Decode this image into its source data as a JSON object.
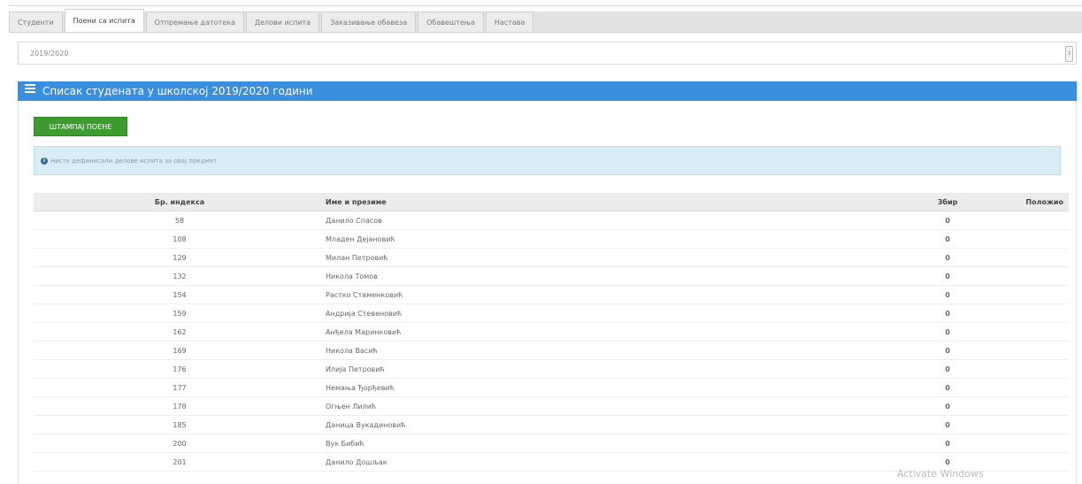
{
  "tabs": [
    {
      "label": "Студенти",
      "active": false
    },
    {
      "label": "Поени са испита",
      "active": true
    },
    {
      "label": "Отпремање датотека",
      "active": false
    },
    {
      "label": "Делови испита",
      "active": false
    },
    {
      "label": "Заказивање обавеза",
      "active": false
    },
    {
      "label": "Обавештења",
      "active": false
    },
    {
      "label": "Настава",
      "active": false
    }
  ],
  "year_select": {
    "value": "2019/2020"
  },
  "panel": {
    "title": "Списак студената у школској 2019/2020 години"
  },
  "print_button": {
    "label": "ШТАМПАЈ ПОЕНЕ"
  },
  "info": {
    "message": "Нисте дефинисали делове испита за овај предмет."
  },
  "table": {
    "headers": {
      "index": "Бр. индекса",
      "name": "Име и презиме",
      "sum": "Збир",
      "passed": "Положио"
    },
    "rows": [
      {
        "index": "58",
        "name": "Данило Спасов",
        "sum": "0"
      },
      {
        "index": "108",
        "name": "Младен Дејановић",
        "sum": "0"
      },
      {
        "index": "129",
        "name": "Милан Петровић",
        "sum": "0"
      },
      {
        "index": "132",
        "name": "Никола Томов",
        "sum": "0"
      },
      {
        "index": "154",
        "name": "Растко Стаменковић",
        "sum": "0"
      },
      {
        "index": "159",
        "name": "Андрија Стевеновић",
        "sum": "0"
      },
      {
        "index": "162",
        "name": "Анђела Маринковић",
        "sum": "0"
      },
      {
        "index": "169",
        "name": "Никола Васић",
        "sum": "0"
      },
      {
        "index": "176",
        "name": "Илија Петровић",
        "sum": "0"
      },
      {
        "index": "177",
        "name": "Немања Ђорђевић",
        "sum": "0"
      },
      {
        "index": "178",
        "name": "Огњен Лилић",
        "sum": "0"
      },
      {
        "index": "185",
        "name": "Даница Вукадиновић",
        "sum": "0"
      },
      {
        "index": "200",
        "name": "Вук Бибић",
        "sum": "0"
      },
      {
        "index": "201",
        "name": "Данило Дошљак",
        "sum": "0"
      }
    ]
  },
  "watermark": "Activate Windows",
  "colors": {
    "header_blue": "#3a8ee0",
    "button_green": "#3c9c2e",
    "info_bg": "#d9edf7"
  }
}
